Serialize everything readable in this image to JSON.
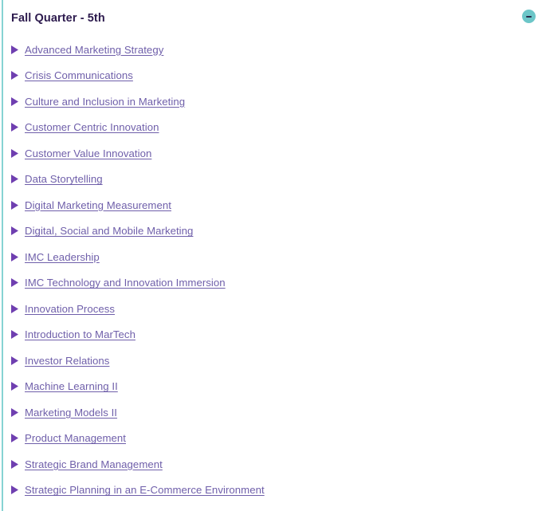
{
  "panel": {
    "title": "Fall Quarter - 5th",
    "collapse_toggle": {
      "icon": "minus-circle-icon",
      "label": "−"
    },
    "accent_teal": "#6cc6c8",
    "rule_teal": "#86d3d3",
    "link_purple": "#6f5faa",
    "title_purple": "#2d1b4e",
    "bullet_icon": "triangle-right-icon",
    "background": "#ffffff"
  },
  "courses": [
    {
      "label": "Advanced Marketing Strategy"
    },
    {
      "label": "Crisis Communications"
    },
    {
      "label": "Culture and Inclusion in Marketing"
    },
    {
      "label": "Customer Centric Innovation"
    },
    {
      "label": "Customer Value Innovation"
    },
    {
      "label": "Data Storytelling"
    },
    {
      "label": "Digital Marketing Measurement"
    },
    {
      "label": "Digital, Social and Mobile Marketing"
    },
    {
      "label": "IMC Leadership"
    },
    {
      "label": "IMC Technology and Innovation Immersion"
    },
    {
      "label": "Innovation Process"
    },
    {
      "label": "Introduction to MarTech"
    },
    {
      "label": "Investor Relations"
    },
    {
      "label": "Machine Learning II"
    },
    {
      "label": "Marketing Models II"
    },
    {
      "label": "Product Management"
    },
    {
      "label": "Strategic Brand Management"
    },
    {
      "label": "Strategic Planning in an E-Commerce Environment"
    }
  ]
}
